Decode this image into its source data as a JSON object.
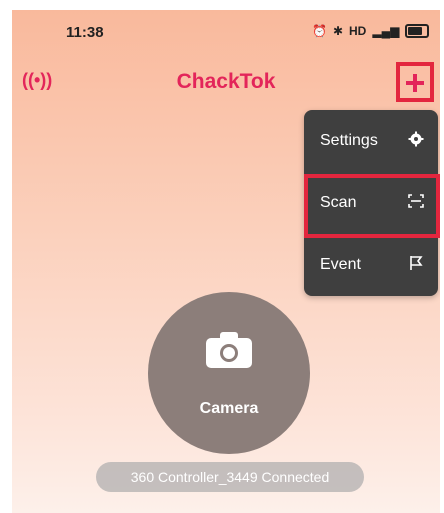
{
  "status_bar": {
    "time": "11:38",
    "icons": [
      "alarm-icon",
      "bluetooth-icon",
      "hd-icon",
      "signal-icon",
      "battery-icon"
    ],
    "hd_label": "HD",
    "signal_label": "⁴ᴳ"
  },
  "app_bar": {
    "title": "ChackTok",
    "broadcast_glyph": "((•))",
    "accent_color": "#e3255a",
    "highlight_color": "#e3263e"
  },
  "menu": {
    "items": [
      {
        "label": "Settings",
        "icon": "gear-icon",
        "glyph": "✹"
      },
      {
        "label": "Scan",
        "icon": "scan-icon",
        "glyph": "⌗"
      },
      {
        "label": "Event",
        "icon": "flag-icon",
        "glyph": "⚐"
      }
    ],
    "background": "#3f3f3f"
  },
  "camera": {
    "label": "Camera"
  },
  "connection_status": "360 Controller_3449 Connected"
}
